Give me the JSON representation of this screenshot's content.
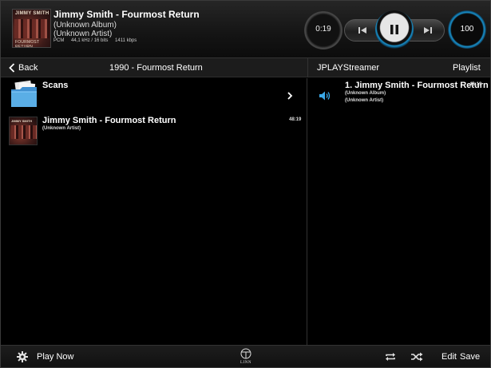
{
  "now_playing": {
    "title": "Jimmy Smith - Fourmost Return",
    "album": "(Unknown Album)",
    "artist": "(Unknown Artist)",
    "format": "PCM",
    "rate": "44,1 kHz / 16 bits",
    "bitrate": "1411 kbps",
    "cover_title": "JIMMY SMITH",
    "cover_subtitle": "FOURMOST RETURN"
  },
  "transport": {
    "elapsed": "0:19",
    "volume": "100",
    "state": "playing",
    "icons": [
      "previous-icon",
      "pause-icon",
      "next-icon"
    ],
    "accent_color": "#1a8fc8"
  },
  "nav": {
    "back_label": "Back",
    "title": "1990 -  Fourmost Return",
    "streamer": "JPLAYStreamer",
    "playlist_label": "Playlist"
  },
  "browser": {
    "folder": {
      "label": "Scans",
      "icon": "folder-icon"
    },
    "track": {
      "title": "Jimmy Smith - Fourmost Return",
      "artist": "(Unknown Artist)",
      "duration": "48:19"
    }
  },
  "playlist": {
    "items": [
      {
        "title": "1. Jimmy Smith - Fourmost Return",
        "album": "(Unknown Album)",
        "artist": "(Unknown Artist)",
        "duration": "48:19",
        "icon": "speaker-icon"
      }
    ]
  },
  "toolbar": {
    "play_now": "Play Now",
    "logo_text": "LINN",
    "edit": "Edit",
    "save": "Save",
    "icons": [
      "gear-icon",
      "repeat-icon",
      "shuffle-icon"
    ]
  }
}
